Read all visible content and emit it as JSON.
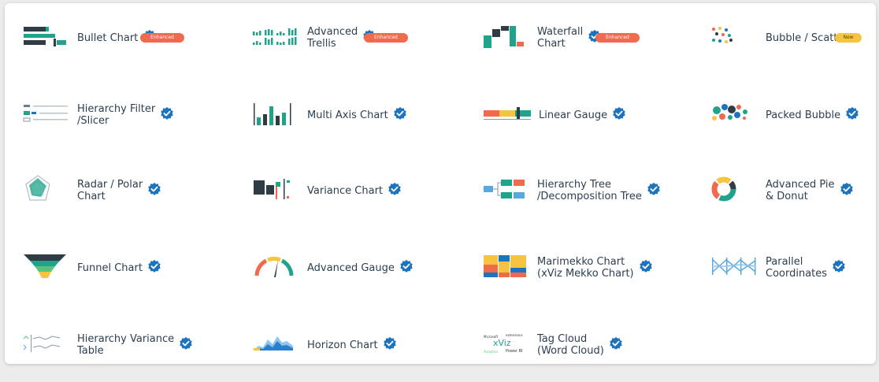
{
  "colors": {
    "verified": "#1e73be",
    "enhanced_badge": "#f06a4e",
    "new_badge": "#f5c542",
    "teal": "#1fa38a",
    "label": "#2c3e50"
  },
  "tiles": [
    {
      "label": "Bullet Chart",
      "badge": "Enhanced",
      "icon": "bullet-chart-icon"
    },
    {
      "label": "Advanced\nTrellis",
      "badge": "Enhanced",
      "icon": "trellis-icon"
    },
    {
      "label": "Waterfall\nChart",
      "badge": "Enhanced",
      "icon": "waterfall-icon"
    },
    {
      "label": "Bubble / Scatter",
      "badge": "New",
      "icon": "scatter-icon"
    },
    {
      "label": "Hierarchy Filter\n/Slicer",
      "icon": "hierarchy-filter-icon"
    },
    {
      "label": "Multi Axis Chart",
      "icon": "multi-axis-icon"
    },
    {
      "label": "Linear Gauge",
      "icon": "linear-gauge-icon"
    },
    {
      "label": "Packed Bubble",
      "icon": "packed-bubble-icon"
    },
    {
      "label": "Radar / Polar\nChart",
      "icon": "radar-icon"
    },
    {
      "label": "Variance Chart",
      "icon": "variance-icon"
    },
    {
      "label": "Hierarchy Tree\n/Decomposition Tree",
      "icon": "hierarchy-tree-icon"
    },
    {
      "label": "Advanced Pie\n& Donut",
      "icon": "pie-donut-icon"
    },
    {
      "label": "Funnel Chart",
      "icon": "funnel-icon"
    },
    {
      "label": "Advanced Gauge",
      "icon": "gauge-icon"
    },
    {
      "label": "Marimekko Chart\n(xViz Mekko Chart)",
      "icon": "marimekko-icon"
    },
    {
      "label": "Parallel\nCoordinates",
      "icon": "parallel-coordinates-icon"
    },
    {
      "label": "Hierarchy Variance\nTable",
      "icon": "variance-table-icon"
    },
    {
      "label": "Horizon Chart",
      "icon": "horizon-icon"
    },
    {
      "label": "Tag Cloud\n(Word Cloud)",
      "icon": "tag-cloud-icon",
      "icon_words": [
        "Microsoft",
        "extensions",
        "xViz",
        "Power BI",
        "Analytics"
      ]
    }
  ]
}
